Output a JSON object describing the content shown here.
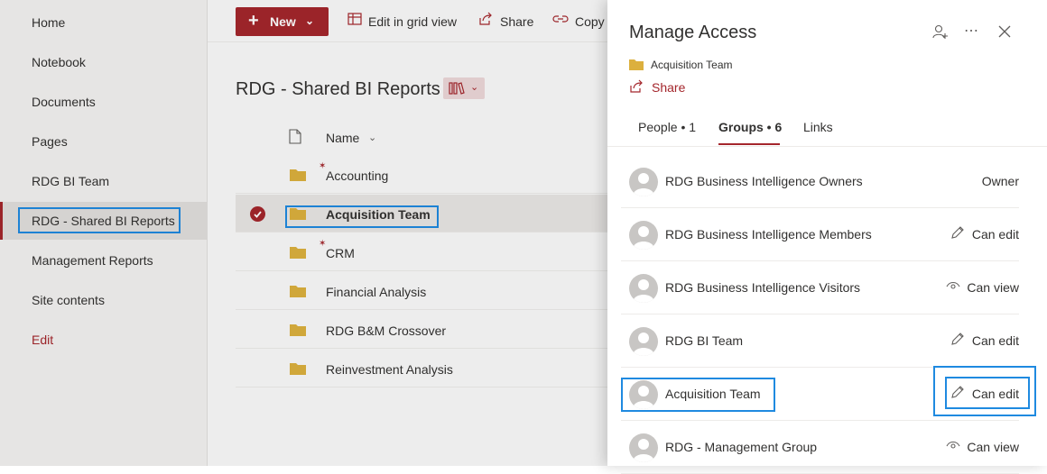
{
  "nav": {
    "items": [
      {
        "label": "Home"
      },
      {
        "label": "Notebook"
      },
      {
        "label": "Documents"
      },
      {
        "label": "Pages"
      },
      {
        "label": "RDG BI Team"
      },
      {
        "label": "RDG - Shared BI Reports"
      },
      {
        "label": "Management Reports"
      },
      {
        "label": "Site contents"
      }
    ],
    "edit_label": "Edit"
  },
  "toolbar": {
    "new_label": "New",
    "grid_label": "Edit in grid view",
    "share_label": "Share",
    "copy_label": "Copy"
  },
  "library": {
    "title": "RDG - Shared BI Reports",
    "name_header": "Name",
    "rows": [
      {
        "name": "Accounting"
      },
      {
        "name": "Acquisition Team"
      },
      {
        "name": "CRM"
      },
      {
        "name": "Financial Analysis"
      },
      {
        "name": "RDG B&M Crossover"
      },
      {
        "name": "Reinvestment Analysis"
      }
    ]
  },
  "panel": {
    "title": "Manage Access",
    "item_name": "Acquisition Team",
    "share_label": "Share",
    "tabs": [
      {
        "label": "People • 1"
      },
      {
        "label": "Groups • 6"
      },
      {
        "label": "Links"
      }
    ],
    "groups": [
      {
        "name": "RDG Business Intelligence Owners",
        "permission": "Owner"
      },
      {
        "name": "RDG Business Intelligence Members",
        "permission": "Can edit"
      },
      {
        "name": "RDG Business Intelligence Visitors",
        "permission": "Can view"
      },
      {
        "name": "RDG BI Team",
        "permission": "Can edit"
      },
      {
        "name": "Acquisition Team",
        "permission": "Can edit"
      },
      {
        "name": "RDG - Management Group",
        "permission": "Can view"
      }
    ]
  },
  "colors": {
    "accent": "#a4262c",
    "highlight_box": "#1f8ae0",
    "folder": "#dcb03e"
  }
}
